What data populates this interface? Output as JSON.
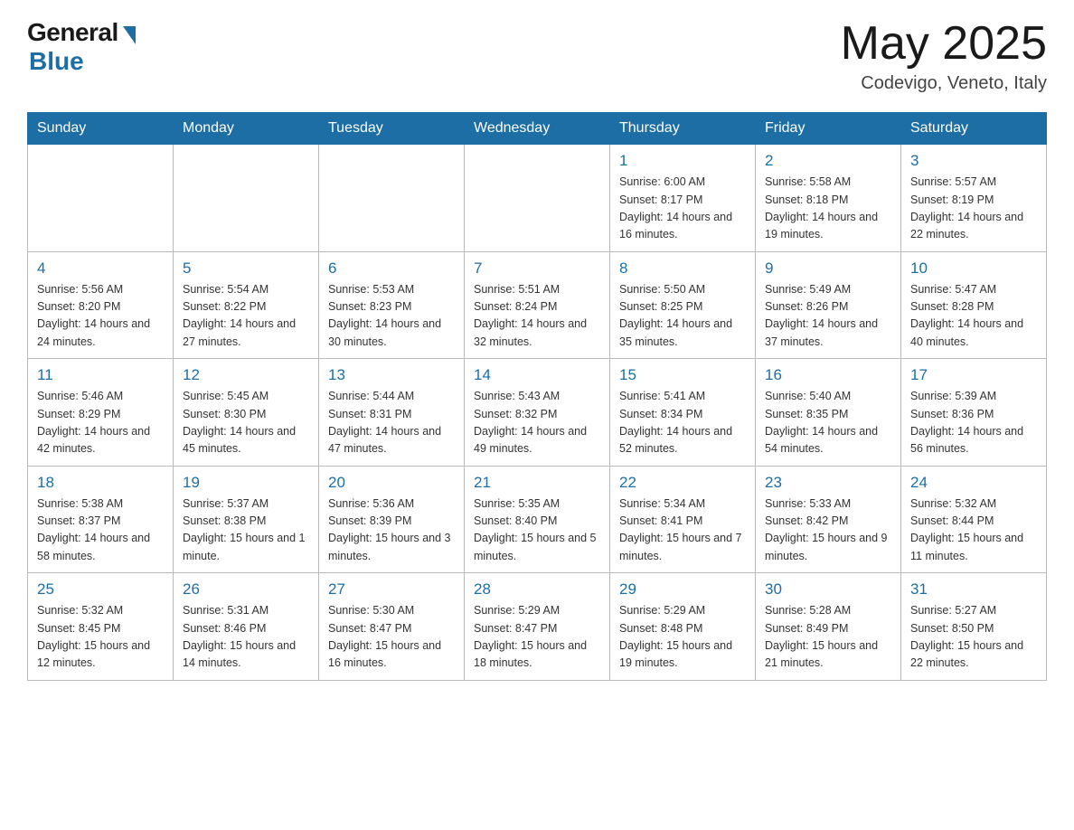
{
  "header": {
    "logo_general": "General",
    "logo_blue": "Blue",
    "month_title": "May 2025",
    "location": "Codevigo, Veneto, Italy"
  },
  "days_of_week": [
    "Sunday",
    "Monday",
    "Tuesday",
    "Wednesday",
    "Thursday",
    "Friday",
    "Saturday"
  ],
  "weeks": [
    [
      {
        "day": "",
        "info": ""
      },
      {
        "day": "",
        "info": ""
      },
      {
        "day": "",
        "info": ""
      },
      {
        "day": "",
        "info": ""
      },
      {
        "day": "1",
        "info": "Sunrise: 6:00 AM\nSunset: 8:17 PM\nDaylight: 14 hours and 16 minutes."
      },
      {
        "day": "2",
        "info": "Sunrise: 5:58 AM\nSunset: 8:18 PM\nDaylight: 14 hours and 19 minutes."
      },
      {
        "day": "3",
        "info": "Sunrise: 5:57 AM\nSunset: 8:19 PM\nDaylight: 14 hours and 22 minutes."
      }
    ],
    [
      {
        "day": "4",
        "info": "Sunrise: 5:56 AM\nSunset: 8:20 PM\nDaylight: 14 hours and 24 minutes."
      },
      {
        "day": "5",
        "info": "Sunrise: 5:54 AM\nSunset: 8:22 PM\nDaylight: 14 hours and 27 minutes."
      },
      {
        "day": "6",
        "info": "Sunrise: 5:53 AM\nSunset: 8:23 PM\nDaylight: 14 hours and 30 minutes."
      },
      {
        "day": "7",
        "info": "Sunrise: 5:51 AM\nSunset: 8:24 PM\nDaylight: 14 hours and 32 minutes."
      },
      {
        "day": "8",
        "info": "Sunrise: 5:50 AM\nSunset: 8:25 PM\nDaylight: 14 hours and 35 minutes."
      },
      {
        "day": "9",
        "info": "Sunrise: 5:49 AM\nSunset: 8:26 PM\nDaylight: 14 hours and 37 minutes."
      },
      {
        "day": "10",
        "info": "Sunrise: 5:47 AM\nSunset: 8:28 PM\nDaylight: 14 hours and 40 minutes."
      }
    ],
    [
      {
        "day": "11",
        "info": "Sunrise: 5:46 AM\nSunset: 8:29 PM\nDaylight: 14 hours and 42 minutes."
      },
      {
        "day": "12",
        "info": "Sunrise: 5:45 AM\nSunset: 8:30 PM\nDaylight: 14 hours and 45 minutes."
      },
      {
        "day": "13",
        "info": "Sunrise: 5:44 AM\nSunset: 8:31 PM\nDaylight: 14 hours and 47 minutes."
      },
      {
        "day": "14",
        "info": "Sunrise: 5:43 AM\nSunset: 8:32 PM\nDaylight: 14 hours and 49 minutes."
      },
      {
        "day": "15",
        "info": "Sunrise: 5:41 AM\nSunset: 8:34 PM\nDaylight: 14 hours and 52 minutes."
      },
      {
        "day": "16",
        "info": "Sunrise: 5:40 AM\nSunset: 8:35 PM\nDaylight: 14 hours and 54 minutes."
      },
      {
        "day": "17",
        "info": "Sunrise: 5:39 AM\nSunset: 8:36 PM\nDaylight: 14 hours and 56 minutes."
      }
    ],
    [
      {
        "day": "18",
        "info": "Sunrise: 5:38 AM\nSunset: 8:37 PM\nDaylight: 14 hours and 58 minutes."
      },
      {
        "day": "19",
        "info": "Sunrise: 5:37 AM\nSunset: 8:38 PM\nDaylight: 15 hours and 1 minute."
      },
      {
        "day": "20",
        "info": "Sunrise: 5:36 AM\nSunset: 8:39 PM\nDaylight: 15 hours and 3 minutes."
      },
      {
        "day": "21",
        "info": "Sunrise: 5:35 AM\nSunset: 8:40 PM\nDaylight: 15 hours and 5 minutes."
      },
      {
        "day": "22",
        "info": "Sunrise: 5:34 AM\nSunset: 8:41 PM\nDaylight: 15 hours and 7 minutes."
      },
      {
        "day": "23",
        "info": "Sunrise: 5:33 AM\nSunset: 8:42 PM\nDaylight: 15 hours and 9 minutes."
      },
      {
        "day": "24",
        "info": "Sunrise: 5:32 AM\nSunset: 8:44 PM\nDaylight: 15 hours and 11 minutes."
      }
    ],
    [
      {
        "day": "25",
        "info": "Sunrise: 5:32 AM\nSunset: 8:45 PM\nDaylight: 15 hours and 12 minutes."
      },
      {
        "day": "26",
        "info": "Sunrise: 5:31 AM\nSunset: 8:46 PM\nDaylight: 15 hours and 14 minutes."
      },
      {
        "day": "27",
        "info": "Sunrise: 5:30 AM\nSunset: 8:47 PM\nDaylight: 15 hours and 16 minutes."
      },
      {
        "day": "28",
        "info": "Sunrise: 5:29 AM\nSunset: 8:47 PM\nDaylight: 15 hours and 18 minutes."
      },
      {
        "day": "29",
        "info": "Sunrise: 5:29 AM\nSunset: 8:48 PM\nDaylight: 15 hours and 19 minutes."
      },
      {
        "day": "30",
        "info": "Sunrise: 5:28 AM\nSunset: 8:49 PM\nDaylight: 15 hours and 21 minutes."
      },
      {
        "day": "31",
        "info": "Sunrise: 5:27 AM\nSunset: 8:50 PM\nDaylight: 15 hours and 22 minutes."
      }
    ]
  ]
}
